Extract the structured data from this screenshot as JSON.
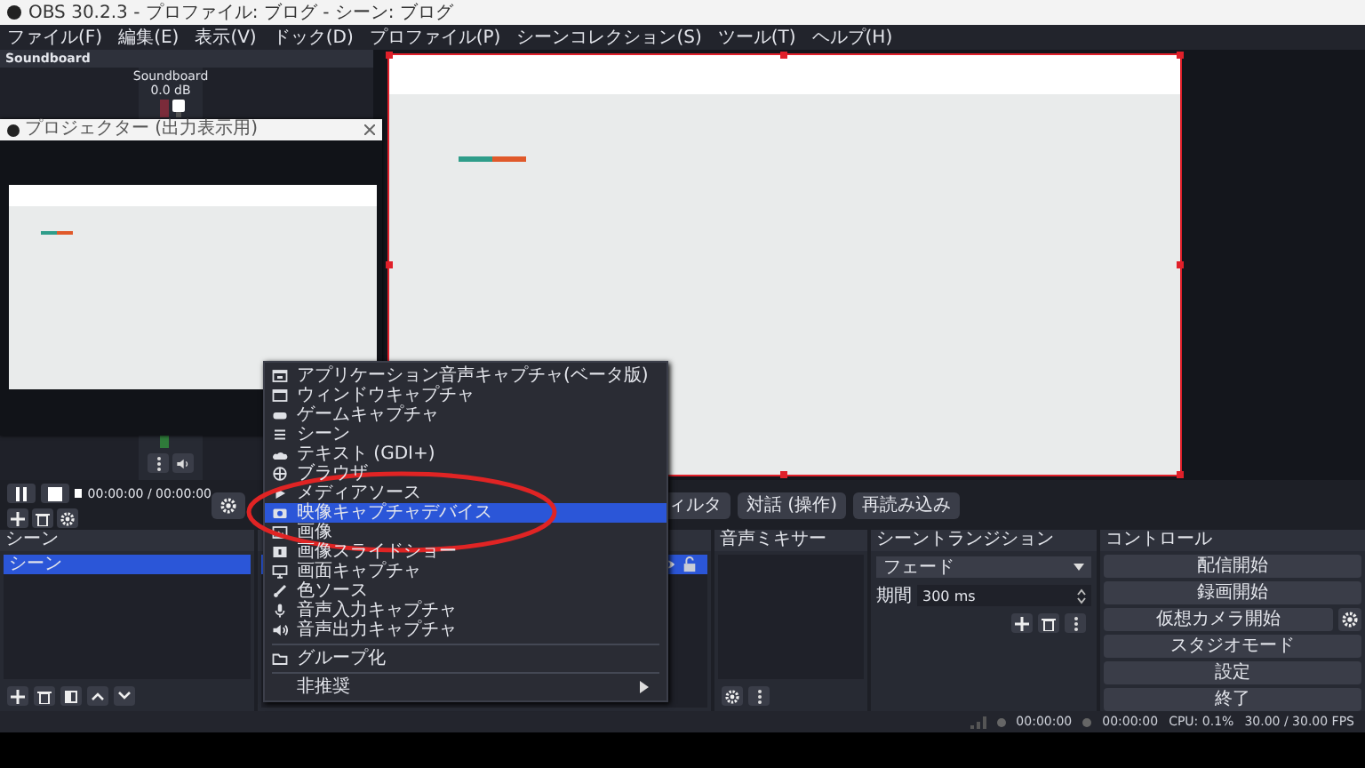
{
  "window": {
    "title": "OBS 30.2.3 - プロファイル: ブログ - シーン: ブログ"
  },
  "menu_bar": [
    "ファイル(F)",
    "編集(E)",
    "表示(V)",
    "ドック(D)",
    "プロファイル(P)",
    "シーンコレクション(S)",
    "ツール(T)",
    "ヘルプ(H)"
  ],
  "soundboard_dock": {
    "title": "Soundboard",
    "channel": {
      "name": "Soundboard",
      "reading": "0.0 dB",
      "level": 1
    }
  },
  "projector_window": {
    "title": "プロジェクター (出力表示用)"
  },
  "playback": {
    "time": "00:00:00 / 00:00:00"
  },
  "source_toolbar": {
    "buttons": [
      "ィルタ",
      "対話 (操作)",
      "再読み込み"
    ]
  },
  "context_menu": {
    "items": [
      {
        "kind": "item",
        "label": "アプリケーション音声キャプチャ(ベータ版)",
        "selected": false
      },
      {
        "kind": "item",
        "label": "ウィンドウキャプチャ",
        "selected": false
      },
      {
        "kind": "item",
        "label": "ゲームキャプチャ",
        "selected": false
      },
      {
        "kind": "item",
        "label": "シーン",
        "selected": false
      },
      {
        "kind": "item",
        "label": "テキスト (GDI+)",
        "selected": false
      },
      {
        "kind": "item",
        "label": "ブラウザ",
        "selected": false
      },
      {
        "kind": "item",
        "label": "メディアソース",
        "selected": false
      },
      {
        "kind": "item",
        "label": "映像キャプチャデバイス",
        "selected": true
      },
      {
        "kind": "item",
        "label": "画像",
        "selected": false
      },
      {
        "kind": "item",
        "label": "画像スライドショー",
        "selected": false
      },
      {
        "kind": "item",
        "label": "画面キャプチャ",
        "selected": false
      },
      {
        "kind": "item",
        "label": "色ソース",
        "selected": false
      },
      {
        "kind": "item",
        "label": "音声入力キャプチャ",
        "selected": false
      },
      {
        "kind": "item",
        "label": "音声出力キャプチャ",
        "selected": false
      },
      {
        "kind": "separator"
      },
      {
        "kind": "item",
        "label": "グループ化",
        "selected": false
      },
      {
        "kind": "separator"
      },
      {
        "kind": "submenu",
        "label": "非推奨",
        "selected": false
      }
    ]
  },
  "scenes": {
    "title": "シーン",
    "items": [
      {
        "label": "シーン",
        "selected": true
      }
    ]
  },
  "sources": {
    "items": [
      {
        "selected": true,
        "visible": true,
        "locked": false
      }
    ]
  },
  "audio_mixer": {
    "title": "音声ミキサー"
  },
  "scene_transitions": {
    "title": "シーントランジション",
    "transition": "フェード",
    "duration_label": "期間",
    "duration": "300 ms"
  },
  "controls": {
    "title": "コントロール",
    "buttons": [
      "配信開始",
      "録画開始",
      "仮想カメラ開始",
      "スタジオモード",
      "設定",
      "終了"
    ]
  },
  "status_bar": {
    "stream_time": "00:00:00",
    "record_time": "00:00:00",
    "cpu": "CPU: 0.1%",
    "fps": "30.00 / 30.00 FPS"
  }
}
